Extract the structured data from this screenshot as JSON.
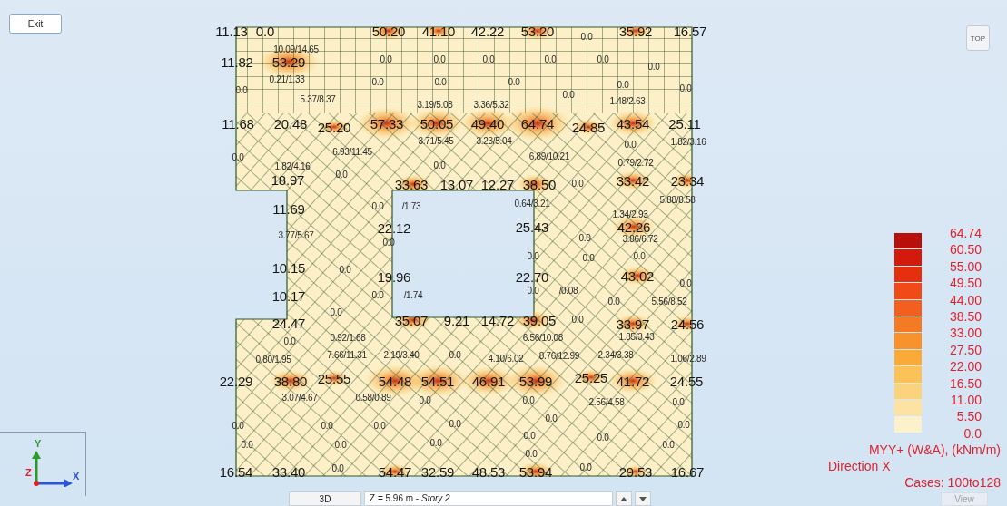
{
  "toolbar": {
    "exit": "Exit",
    "top": "TOP"
  },
  "labels": [
    {
      "text": "11.13",
      "kind": "major"
    },
    {
      "text": "0.0",
      "kind": "major"
    },
    {
      "text": "50.20",
      "kind": "major"
    },
    {
      "text": "41.10",
      "kind": "major"
    },
    {
      "text": "42.22",
      "kind": "major"
    },
    {
      "text": "53.20",
      "kind": "major"
    },
    {
      "text": "0.0",
      "kind": "minor"
    },
    {
      "text": "35.92",
      "kind": "major"
    },
    {
      "text": "16.57",
      "kind": "major"
    },
    {
      "text": "10.09/14.65",
      "kind": "minor"
    },
    {
      "text": "11.82",
      "kind": "major"
    },
    {
      "text": "53.29",
      "kind": "major"
    },
    {
      "text": "0.0",
      "kind": "minor"
    },
    {
      "text": "0.0",
      "kind": "minor"
    },
    {
      "text": "0.0",
      "kind": "minor"
    },
    {
      "text": "0.0",
      "kind": "minor"
    },
    {
      "text": "0.0",
      "kind": "minor"
    },
    {
      "text": "0.0",
      "kind": "minor"
    },
    {
      "text": "0.21/1.33",
      "kind": "minor"
    },
    {
      "text": "0.0",
      "kind": "minor"
    },
    {
      "text": "0.0",
      "kind": "minor"
    },
    {
      "text": "0.0",
      "kind": "minor"
    },
    {
      "text": "0.0",
      "kind": "minor"
    },
    {
      "text": "0.0",
      "kind": "minor"
    },
    {
      "text": "0.0",
      "kind": "minor"
    },
    {
      "text": "0.0",
      "kind": "minor"
    },
    {
      "text": "5.37/8.37",
      "kind": "minor"
    },
    {
      "text": "3.19/5.08",
      "kind": "minor"
    },
    {
      "text": "3.36/5.32",
      "kind": "minor"
    },
    {
      "text": "1.48/2.63",
      "kind": "minor"
    },
    {
      "text": "11.68",
      "kind": "major"
    },
    {
      "text": "20.48",
      "kind": "major"
    },
    {
      "text": "25.20",
      "kind": "major"
    },
    {
      "text": "57.33",
      "kind": "major"
    },
    {
      "text": "50.05",
      "kind": "major"
    },
    {
      "text": "49.40",
      "kind": "major"
    },
    {
      "text": "64.74",
      "kind": "major"
    },
    {
      "text": "24.85",
      "kind": "major"
    },
    {
      "text": "43.54",
      "kind": "major"
    },
    {
      "text": "25.11",
      "kind": "major"
    },
    {
      "text": "3.71/5.45",
      "kind": "minor"
    },
    {
      "text": "3.23/5.04",
      "kind": "minor"
    },
    {
      "text": "0.0",
      "kind": "minor"
    },
    {
      "text": "1.82/3.16",
      "kind": "minor"
    },
    {
      "text": "6.93/11.45",
      "kind": "minor"
    },
    {
      "text": "6.89/10.21",
      "kind": "minor"
    },
    {
      "text": "0.0",
      "kind": "minor"
    },
    {
      "text": "0.79/2.72",
      "kind": "minor"
    },
    {
      "text": "1.82/4.16",
      "kind": "minor"
    },
    {
      "text": "0.0",
      "kind": "minor"
    },
    {
      "text": "18.97",
      "kind": "major"
    },
    {
      "text": "0.0",
      "kind": "minor"
    },
    {
      "text": "33.63",
      "kind": "major"
    },
    {
      "text": "13.07",
      "kind": "major"
    },
    {
      "text": "12.27",
      "kind": "major"
    },
    {
      "text": "38.50",
      "kind": "major"
    },
    {
      "text": "0.0",
      "kind": "minor"
    },
    {
      "text": "33.42",
      "kind": "major"
    },
    {
      "text": "23.34",
      "kind": "major"
    },
    {
      "text": "11.69",
      "kind": "major"
    },
    {
      "text": "0.0",
      "kind": "minor"
    },
    {
      "text": "/1.73",
      "kind": "minor"
    },
    {
      "text": "0.64/3.21",
      "kind": "minor"
    },
    {
      "text": "5.88/8.58",
      "kind": "minor"
    },
    {
      "text": "1.34/2.93",
      "kind": "minor"
    },
    {
      "text": "22.12",
      "kind": "major"
    },
    {
      "text": "25.43",
      "kind": "major"
    },
    {
      "text": "42.26",
      "kind": "major"
    },
    {
      "text": "3.77/5.67",
      "kind": "minor"
    },
    {
      "text": "0.0",
      "kind": "minor"
    },
    {
      "text": "0.0",
      "kind": "minor"
    },
    {
      "text": "3.86/6.72",
      "kind": "minor"
    },
    {
      "text": "0.0",
      "kind": "minor"
    },
    {
      "text": "0.0",
      "kind": "minor"
    },
    {
      "text": "0.0",
      "kind": "minor"
    },
    {
      "text": "10.15",
      "kind": "major"
    },
    {
      "text": "0.0",
      "kind": "minor"
    },
    {
      "text": "19.96",
      "kind": "major"
    },
    {
      "text": "22.70",
      "kind": "major"
    },
    {
      "text": "43.02",
      "kind": "major"
    },
    {
      "text": "0.0",
      "kind": "minor"
    },
    {
      "text": "10.17",
      "kind": "major"
    },
    {
      "text": "0.0",
      "kind": "minor"
    },
    {
      "text": "/1.74",
      "kind": "minor"
    },
    {
      "text": "0.0",
      "kind": "minor"
    },
    {
      "text": "/0.08",
      "kind": "minor"
    },
    {
      "text": "0.0",
      "kind": "minor"
    },
    {
      "text": "5.56/8.52",
      "kind": "minor"
    },
    {
      "text": "0.0",
      "kind": "minor"
    },
    {
      "text": "24.47",
      "kind": "major"
    },
    {
      "text": "35.07",
      "kind": "major"
    },
    {
      "text": "9.21",
      "kind": "major"
    },
    {
      "text": "14.72",
      "kind": "major"
    },
    {
      "text": "39.05",
      "kind": "major"
    },
    {
      "text": "0.0",
      "kind": "minor"
    },
    {
      "text": "33.97",
      "kind": "major"
    },
    {
      "text": "24.56",
      "kind": "major"
    },
    {
      "text": "0.0",
      "kind": "minor"
    },
    {
      "text": "0.92/1.68",
      "kind": "minor"
    },
    {
      "text": "6.56/10.08",
      "kind": "minor"
    },
    {
      "text": "1.85/3.43",
      "kind": "minor"
    },
    {
      "text": "0.80/1.95",
      "kind": "minor"
    },
    {
      "text": "7.66/11.31",
      "kind": "minor"
    },
    {
      "text": "2.19/3.40",
      "kind": "minor"
    },
    {
      "text": "0.0",
      "kind": "minor"
    },
    {
      "text": "4.10/6.02",
      "kind": "minor"
    },
    {
      "text": "8.76/12.99",
      "kind": "minor"
    },
    {
      "text": "2.34/3.38",
      "kind": "minor"
    },
    {
      "text": "1.06/2.89",
      "kind": "minor"
    },
    {
      "text": "22.29",
      "kind": "major"
    },
    {
      "text": "38.80",
      "kind": "major"
    },
    {
      "text": "25.55",
      "kind": "major"
    },
    {
      "text": "54.48",
      "kind": "major"
    },
    {
      "text": "54.51",
      "kind": "major"
    },
    {
      "text": "46.91",
      "kind": "major"
    },
    {
      "text": "53.99",
      "kind": "major"
    },
    {
      "text": "25.25",
      "kind": "major"
    },
    {
      "text": "41.72",
      "kind": "major"
    },
    {
      "text": "24.55",
      "kind": "major"
    },
    {
      "text": "3.07/4.67",
      "kind": "minor"
    },
    {
      "text": "0.58/0.89",
      "kind": "minor"
    },
    {
      "text": "0.0",
      "kind": "minor"
    },
    {
      "text": "0.0",
      "kind": "minor"
    },
    {
      "text": "2.56/4.58",
      "kind": "minor"
    },
    {
      "text": "0.0",
      "kind": "minor"
    },
    {
      "text": "0.0",
      "kind": "minor"
    },
    {
      "text": "0.0",
      "kind": "minor"
    },
    {
      "text": "0.0",
      "kind": "minor"
    },
    {
      "text": "0.0",
      "kind": "minor"
    },
    {
      "text": "0.0",
      "kind": "minor"
    },
    {
      "text": "0.0",
      "kind": "minor"
    },
    {
      "text": "0.0",
      "kind": "minor"
    },
    {
      "text": "0.0",
      "kind": "minor"
    },
    {
      "text": "0.0",
      "kind": "minor"
    },
    {
      "text": "0.0",
      "kind": "minor"
    },
    {
      "text": "0.0",
      "kind": "minor"
    },
    {
      "text": "0.0",
      "kind": "minor"
    },
    {
      "text": "0.0",
      "kind": "minor"
    },
    {
      "text": "16.54",
      "kind": "major"
    },
    {
      "text": "33.40",
      "kind": "major"
    },
    {
      "text": "0.0",
      "kind": "minor"
    },
    {
      "text": "54.47",
      "kind": "major"
    },
    {
      "text": "32.59",
      "kind": "major"
    },
    {
      "text": "48.53",
      "kind": "major"
    },
    {
      "text": "53.94",
      "kind": "major"
    },
    {
      "text": "0.0",
      "kind": "minor"
    },
    {
      "text": "29.53",
      "kind": "major"
    },
    {
      "text": "16.67",
      "kind": "major"
    }
  ],
  "legend": {
    "labels": [
      "64.74",
      "60.50",
      "55.00",
      "49.50",
      "44.00",
      "38.50",
      "33.00",
      "27.50",
      "22.00",
      "16.50",
      "11.00",
      "5.50",
      "0.0"
    ],
    "bands": [
      {
        "color": "#b80f0a"
      },
      {
        "color": "#d41a0c"
      },
      {
        "color": "#e5300f"
      },
      {
        "color": "#ef4a18"
      },
      {
        "color": "#f35f1e"
      },
      {
        "color": "#f57a24"
      },
      {
        "color": "#f7922c"
      },
      {
        "color": "#f9ab3a"
      },
      {
        "color": "#fac257"
      },
      {
        "color": "#fbd37c"
      },
      {
        "color": "#fce3a2"
      },
      {
        "color": "#fdf1cc"
      }
    ],
    "title": "MYY+ (W&A), (kNm/m)",
    "direction": "Direction X",
    "cases": "Cases: 100to128"
  },
  "axes": {
    "y": "Y",
    "z": "Z",
    "x": "X"
  },
  "bottom_bar": {
    "mode": "3D",
    "level_prefix": "Z = 5.96 m - ",
    "level_story": "Story 2",
    "view": "View"
  }
}
